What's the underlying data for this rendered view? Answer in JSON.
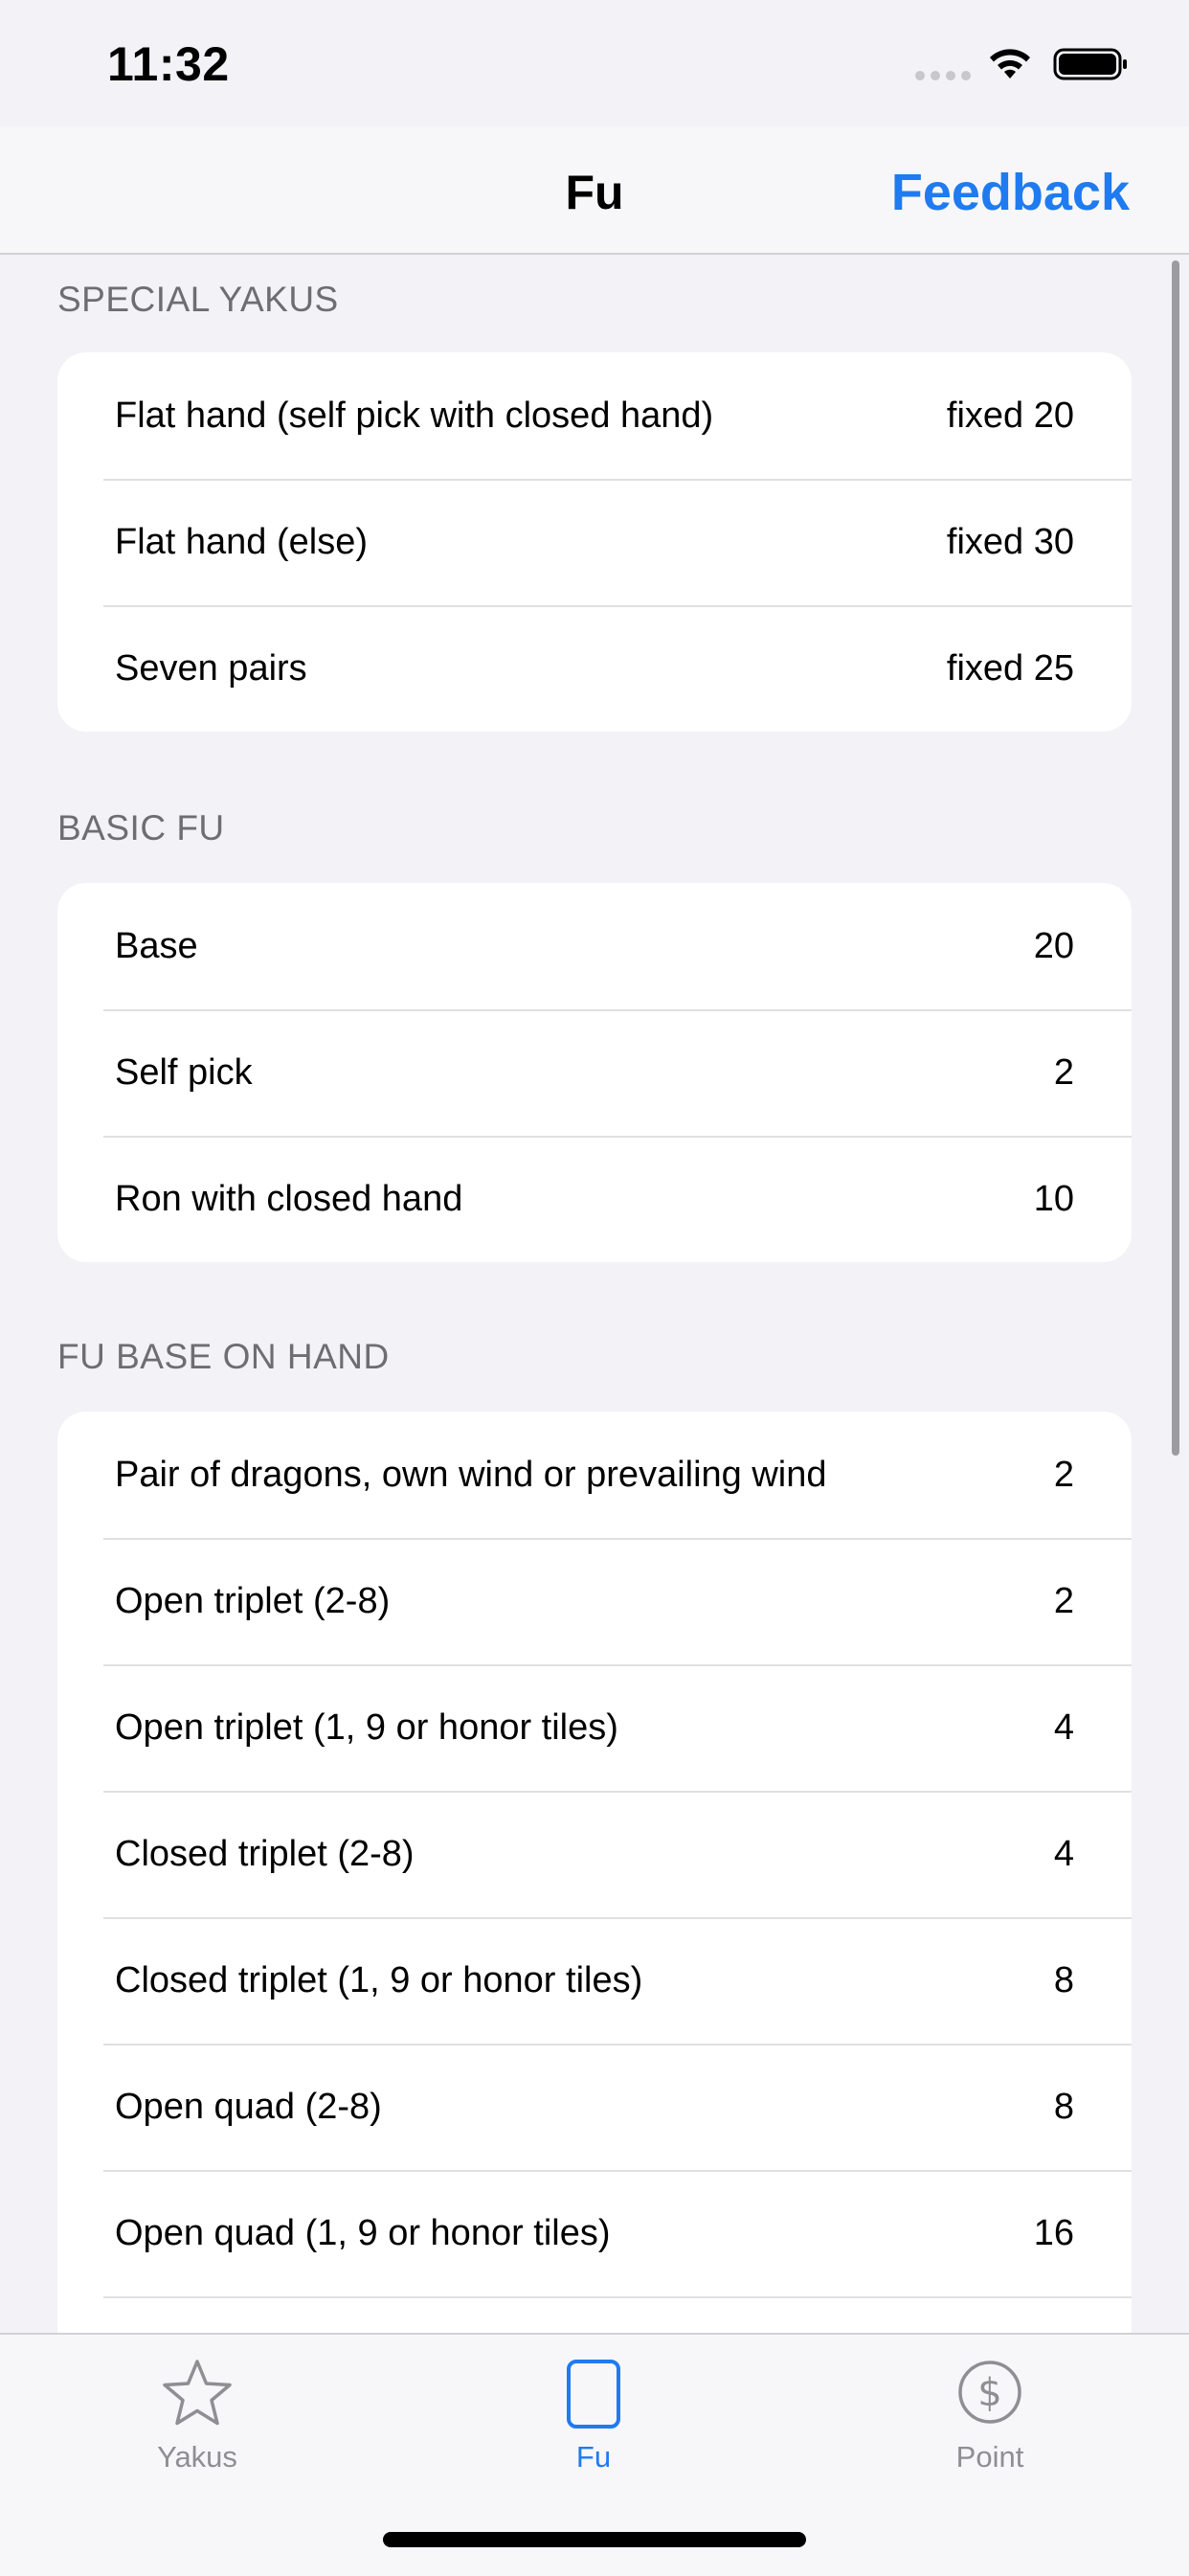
{
  "status_bar": {
    "time": "11:32"
  },
  "nav": {
    "title": "Fu",
    "feedback_label": "Feedback"
  },
  "sections": [
    {
      "header": "SPECIAL YAKUS",
      "rows": [
        {
          "label": "Flat hand (self pick with closed hand)",
          "value": "fixed 20"
        },
        {
          "label": "Flat hand (else)",
          "value": "fixed 30"
        },
        {
          "label": "Seven pairs",
          "value": "fixed 25"
        }
      ]
    },
    {
      "header": "BASIC FU",
      "rows": [
        {
          "label": "Base",
          "value": "20"
        },
        {
          "label": "Self pick",
          "value": "2"
        },
        {
          "label": "Ron with closed hand",
          "value": "10"
        }
      ]
    },
    {
      "header": "FU BASE ON HAND",
      "rows": [
        {
          "label": "Pair of dragons, own wind or prevailing wind",
          "value": "2"
        },
        {
          "label": "Open triplet (2-8)",
          "value": "2"
        },
        {
          "label": "Open triplet (1, 9 or honor tiles)",
          "value": "4"
        },
        {
          "label": "Closed triplet (2-8)",
          "value": "4"
        },
        {
          "label": "Closed triplet (1, 9 or honor tiles)",
          "value": "8"
        },
        {
          "label": "Open quad (2-8)",
          "value": "8"
        },
        {
          "label": "Open quad (1, 9 or honor tiles)",
          "value": "16"
        }
      ]
    }
  ],
  "tabs": [
    {
      "label": "Yakus",
      "icon": "star-icon",
      "selected": false
    },
    {
      "label": "Fu",
      "icon": "tile-icon",
      "selected": true
    },
    {
      "label": "Point",
      "icon": "dollar-circle-icon",
      "selected": false
    }
  ],
  "colors": {
    "accent": "#1F7BEF",
    "background": "#F2F2F7",
    "inactive_tab": "#8E8E93"
  }
}
